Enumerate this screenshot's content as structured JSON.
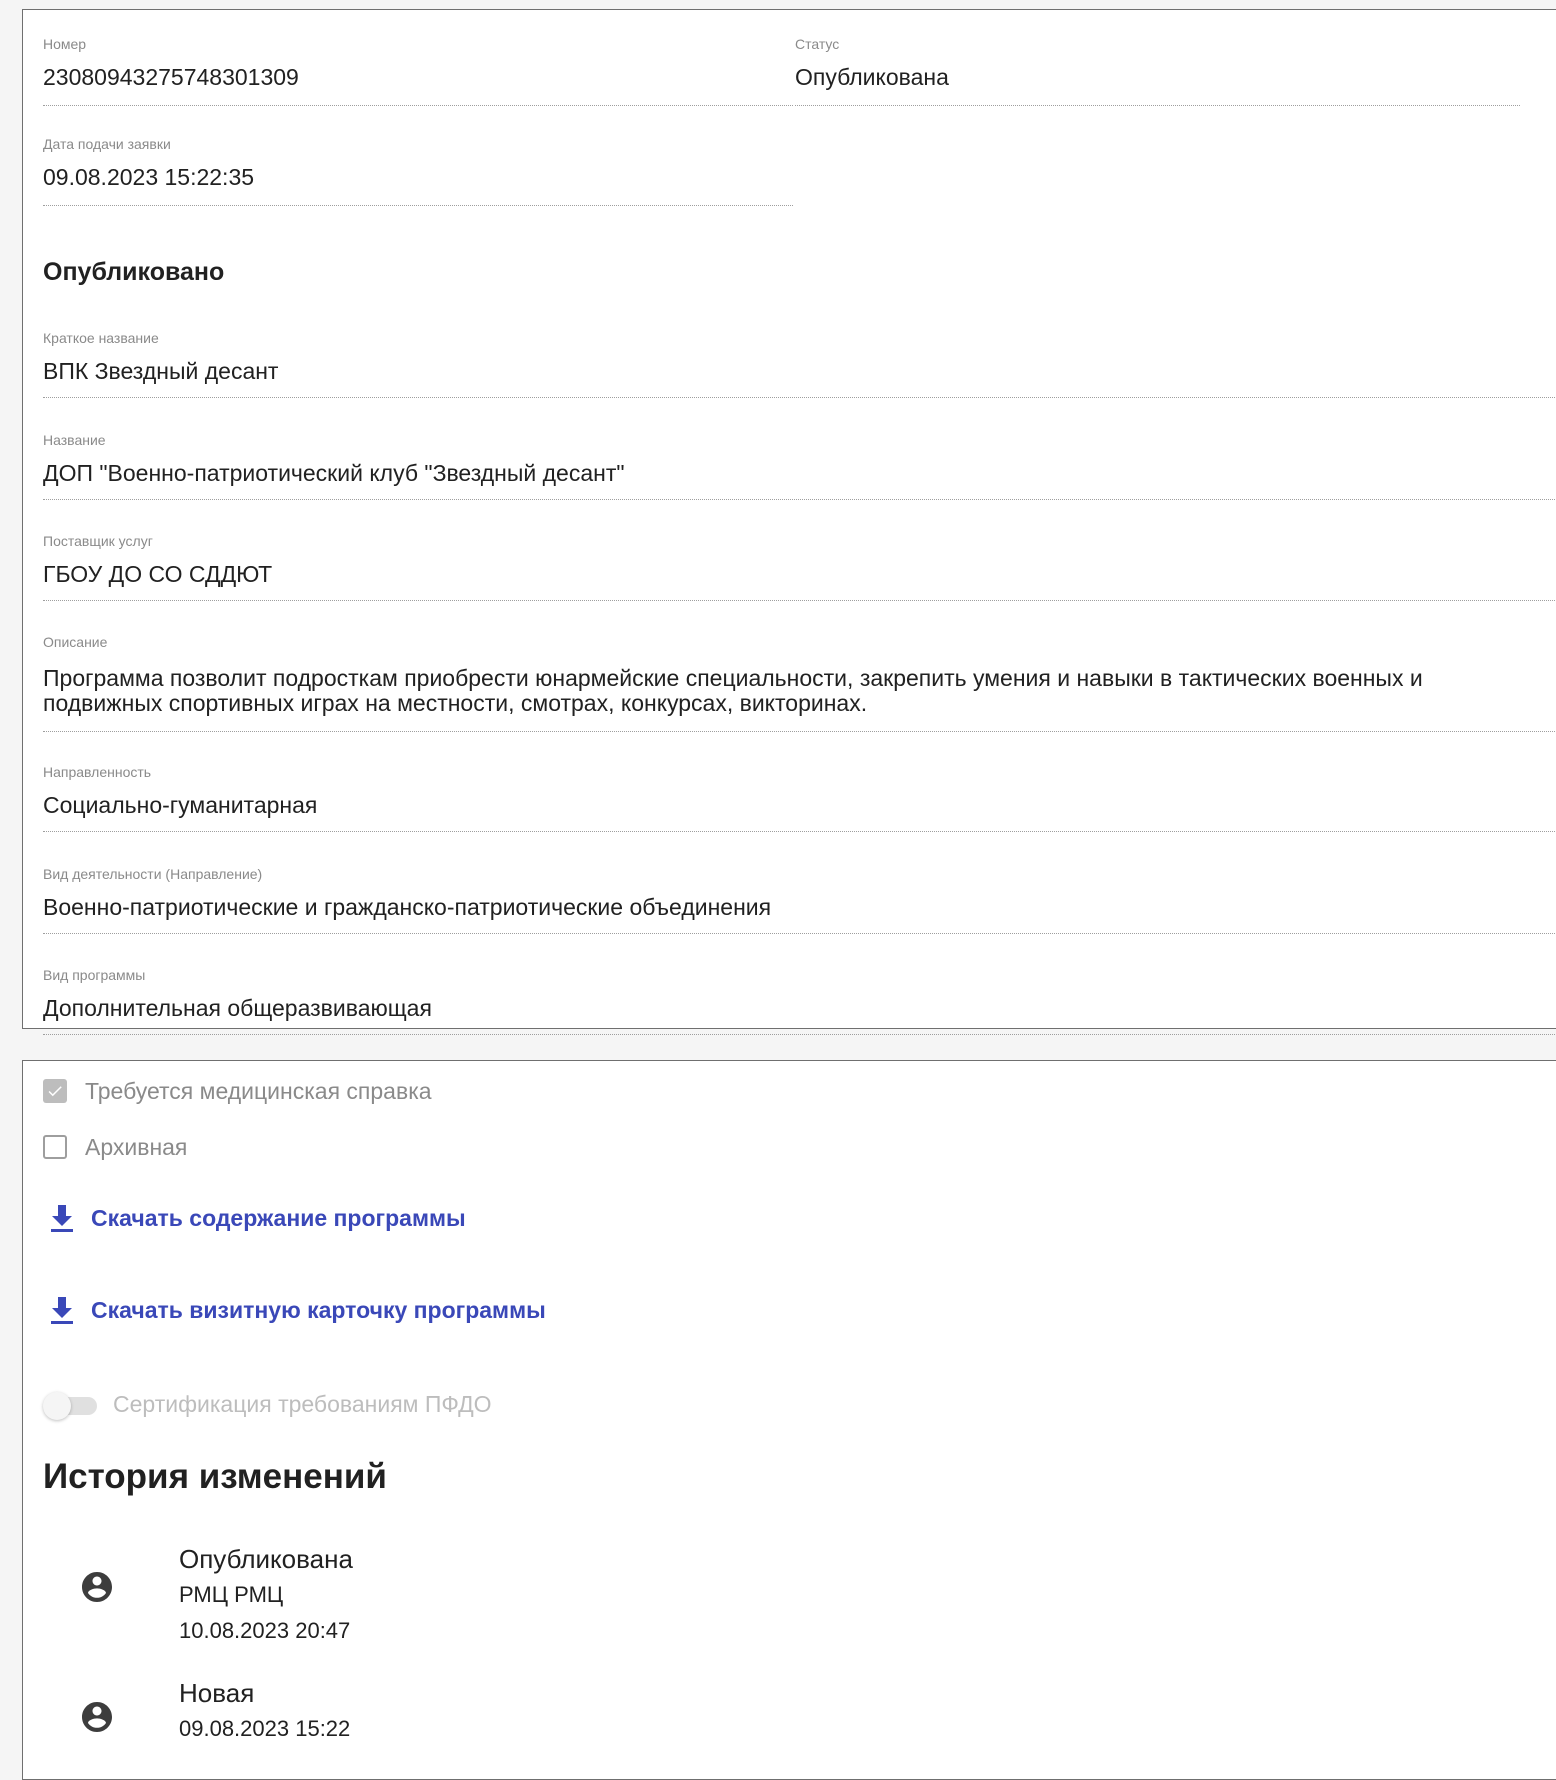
{
  "application": {
    "number_label": "Номер",
    "number_value": "23080943275748301309",
    "status_label": "Статус",
    "status_value": "Опубликована",
    "date_label": "Дата подачи заявки",
    "date_value": "09.08.2023 15:22:35"
  },
  "published": {
    "section_title": "Опубликовано",
    "short_name_label": "Краткое название",
    "short_name_value": "ВПК Звездный десант",
    "name_label": "Название",
    "name_value": "ДОП \"Военно-патриотический клуб \"Звездный десант\"",
    "provider_label": "Поставщик услуг",
    "provider_value": "ГБОУ ДО СО СДДЮТ",
    "description_label": "Описание",
    "description_value": "Программа позволит подросткам приобрести юнармейские специальности, закрепить умения и навыки в тактических военных и подвижных спортивных играх на местности, смотрах, конкурсах, викторинах.",
    "focus_label": "Направленность",
    "focus_value": "Социально-гуманитарная",
    "activity_label": "Вид деятельности (Направление)",
    "activity_value": "Военно-патриотические и гражданско-патриотические объединения",
    "program_type_label": "Вид программы",
    "program_type_value": "Дополнительная общеразвивающая"
  },
  "options": {
    "medical_label": "Требуется медицинская справка",
    "medical_checked": true,
    "archive_label": "Архивная",
    "archive_checked": false,
    "download_content_label": "Скачать содержание программы",
    "download_card_label": "Скачать визитную карточку программы",
    "certification_label": "Сертификация требованиям ПФДО",
    "certification_on": false
  },
  "history": {
    "title": "История изменений",
    "entries": [
      {
        "status": "Опубликована",
        "user": "РМЦ РМЦ",
        "time": "10.08.2023 20:47",
        "icon": "account-circle-icon"
      },
      {
        "status": "Новая",
        "user": "",
        "time": "09.08.2023 15:22",
        "icon": "account-circle-icon"
      }
    ]
  },
  "colors": {
    "link": "#3a48b8",
    "label_grey": "#8a8a8a",
    "text": "#212121",
    "disabled": "#bdbdbd"
  }
}
